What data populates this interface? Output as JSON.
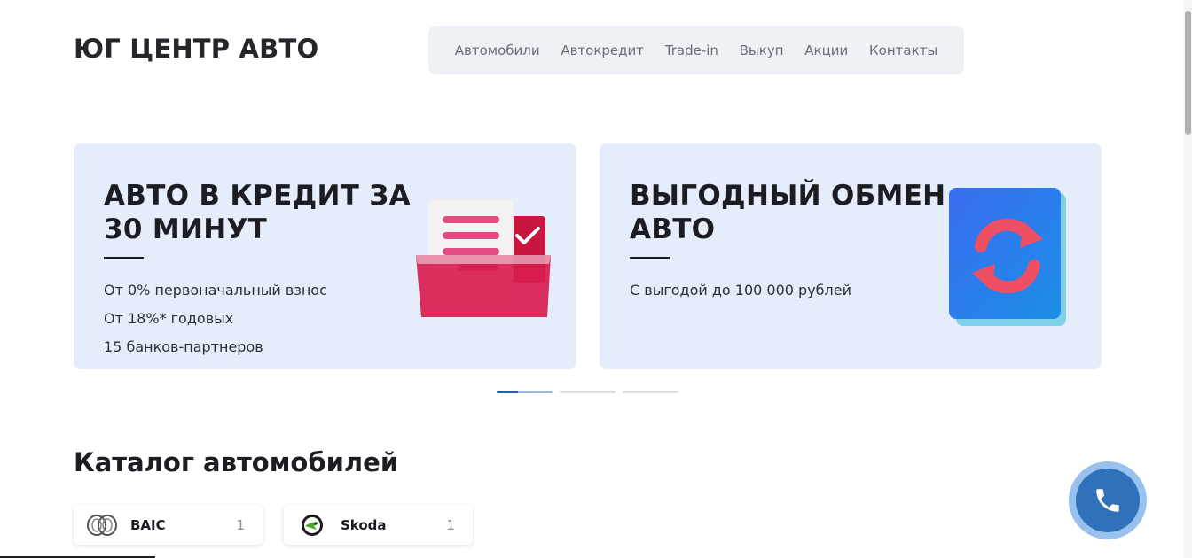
{
  "header": {
    "logo": "ЮГ ЦЕНТР АВТО",
    "nav": [
      "Автомобили",
      "Автокредит",
      "Trade-in",
      "Выкуп",
      "Акции",
      "Контакты"
    ]
  },
  "slides": [
    {
      "title_line1": "АВТО В КРЕДИТ ЗА",
      "title_line2": "30 МИНУТ",
      "bullets": [
        "От 0% первоначальный взнос",
        "От 18%* годовых",
        "15 банков-партнеров"
      ],
      "icon": "credit-folder-icon"
    },
    {
      "title_line1": "ВЫГОДНЫЙ ОБМЕН",
      "title_line2": "АВТО",
      "bullets": [
        "С выгодой до 100 000 рублей"
      ],
      "icon": "exchange-arrows-icon"
    }
  ],
  "carousel": {
    "total_dots": 3,
    "active_index": 0,
    "progress": 0.38
  },
  "catalog": {
    "title": "Каталог автомобилей",
    "brands": [
      {
        "name": "BAIC",
        "count": "1",
        "icon": "baic-logo-icon"
      },
      {
        "name": "Skoda",
        "count": "1",
        "icon": "skoda-logo-icon"
      }
    ]
  },
  "call_button": {
    "icon": "phone-icon"
  },
  "colors": {
    "accent": "#2f71ba",
    "card_bg": "#e6edfa",
    "nav_bg": "#eef1f6"
  }
}
